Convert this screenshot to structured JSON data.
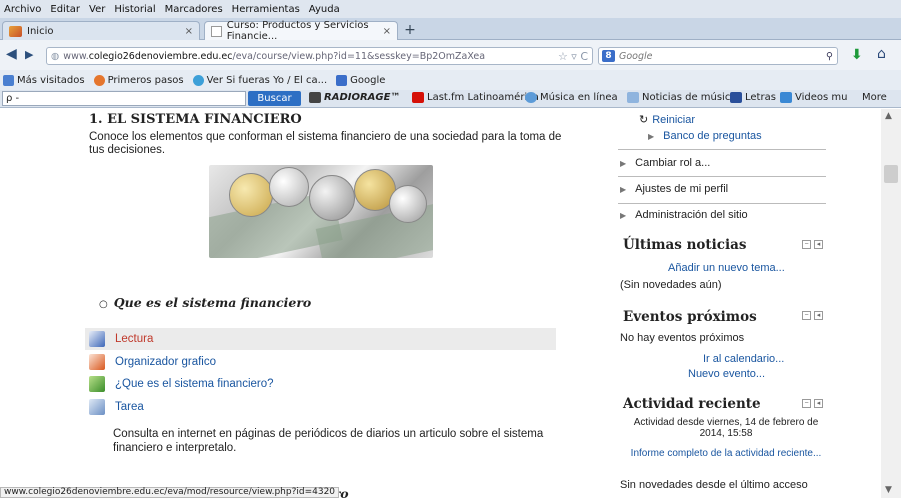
{
  "menu": {
    "items": [
      "Archivo",
      "Editar",
      "Ver",
      "Historial",
      "Marcadores",
      "Herramientas",
      "Ayuda"
    ]
  },
  "tabs": [
    {
      "label": "Inicio"
    },
    {
      "label": "Curso: Productos y Servicios Financie..."
    }
  ],
  "nav": {
    "url_prefix": "www.",
    "url_domain": "colegio26denoviembre.edu.ec",
    "url_path": "/eva/course/view.php?id=11&sesskey=Bp2OmZaXea",
    "search_engine": "Google",
    "search_placeholder": "Google"
  },
  "bookmarks": [
    {
      "label": "Más visitados",
      "color": "#4a7fd0"
    },
    {
      "label": "Primeros pasos",
      "color": "#e5762d"
    },
    {
      "label": "Ver Si fueras Yo / El ca...",
      "color": "#3da0d8"
    },
    {
      "label": "Google",
      "color": "#3b6ec9"
    }
  ],
  "toolbar": {
    "search_prefix": "ρ -",
    "buscar": "Buscar",
    "radiorage": "RADIORAGE™",
    "lastfm": "Last.fm Latinoamérica",
    "musica": "Música en línea",
    "noticias": "Noticias de música",
    "letras": "Letras",
    "videos": "Videos musica",
    "more": "More"
  },
  "main": {
    "title": "1. EL SISTEMA FINANCIERO",
    "description": "Conoce los elementos que conforman el sistema financiero de una sociedad para la toma de tus decisiones.",
    "subheading": "Que es el sistema financiero",
    "resources": [
      {
        "label": "Lectura",
        "icon": "word-doc-icon",
        "color": "#c0392b"
      },
      {
        "label": "Organizador grafico",
        "icon": "pdf-doc-icon",
        "color": "#1a56a0"
      },
      {
        "label": "¿Que es el sistema financiero?",
        "icon": "forum-icon",
        "color": "#1a56a0"
      },
      {
        "label": "Tarea",
        "icon": "assignment-icon",
        "color": "#1a56a0"
      }
    ],
    "task_description": "Consulta en internet en páginas de periódicos de diarios un articulo sobre el sistema financiero e interpretalo.",
    "partial_heading": "iero",
    "status_url": "www.colegio26denoviembre.edu.ec/eva/mod/resource/view.php?id=4320"
  },
  "sidebar": {
    "admin": {
      "reiniciar": "Reiniciar",
      "banco": "Banco de preguntas",
      "cambiar_rol": "Cambiar rol a...",
      "ajustes": "Ajustes de mi perfil",
      "administracion": "Administración del sitio"
    },
    "news": {
      "title": "Últimas noticias",
      "add": "Añadir un nuevo tema...",
      "empty": "(Sin novedades aún)"
    },
    "events": {
      "title": "Eventos próximos",
      "none": "No hay eventos próximos",
      "calendar": "Ir al calendario...",
      "new": "Nuevo evento..."
    },
    "activity": {
      "title": "Actividad reciente",
      "since": "Actividad desde viernes, 14 de febrero de 2014, 15:58",
      "report": "Informe completo de la actividad reciente...",
      "nonews": "Sin novedades desde el último acceso"
    }
  }
}
